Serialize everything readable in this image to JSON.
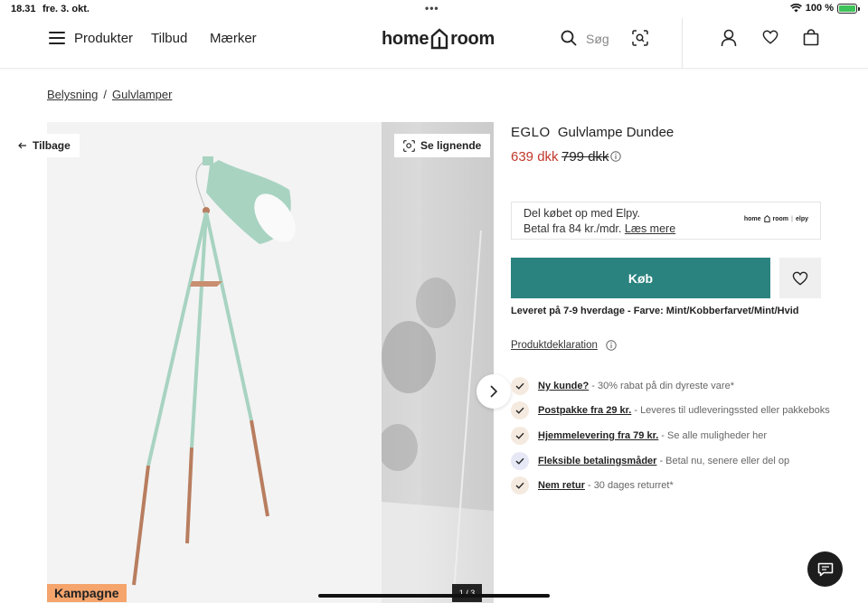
{
  "statusbar": {
    "time": "18.31",
    "date": "fre. 3. okt.",
    "dots": "•••",
    "battery_text": "100 %"
  },
  "header": {
    "nav": [
      "Produkter",
      "Tilbud",
      "Mærker"
    ],
    "logo_left": "home",
    "logo_right": "room",
    "search_placeholder": "Søg"
  },
  "breadcrumb": {
    "items": [
      "Belysning",
      "Gulvlamper"
    ],
    "separator": "/"
  },
  "gallery": {
    "back_label": "Tilbage",
    "similar_label": "Se lignende",
    "campaign_label": "Kampagne",
    "counter": "1 / 3"
  },
  "product": {
    "brand": "EGLO",
    "name": "Gulvlampe Dundee",
    "price": "639 dkk",
    "old_price": "799 dkk",
    "price_color": "#c0392b"
  },
  "elpy": {
    "line1": "Del købet op med Elpy.",
    "line2_prefix": "Betal fra 84 kr./mdr.",
    "line2_link": "Læs mere",
    "logo_home": "home",
    "logo_room": "room",
    "logo_elpy": "elpy"
  },
  "buy": {
    "label": "Køb",
    "color": "#2a837f"
  },
  "delivery_text": "Leveret på 7-9 hverdage - Farve: Mint/Kobberfarvet/Mint/Hvid",
  "declaration_label": "Produktdeklaration",
  "usps": [
    {
      "strong": "Ny kunde?",
      "text": "- 30% rabat på din dyreste vare*",
      "icon": "check-icon"
    },
    {
      "strong": "Postpakke fra 29 kr.",
      "text": "- Leveres til udleveringssted eller pakkeboks",
      "icon": "check-icon"
    },
    {
      "strong": "Hjemmelevering fra 79 kr.",
      "text": "- Se alle muligheder her",
      "icon": "check-icon"
    },
    {
      "strong": "Fleksible betalingsmåder",
      "text": "- Betal nu, senere eller del op",
      "icon": "check-icon"
    },
    {
      "strong": "Nem retur",
      "text": "- 30 dages returret*",
      "icon": "check-icon"
    }
  ],
  "colors": {
    "campaign": "#f5a46c",
    "lamp": "#a8d3c1",
    "copper": "#b87d5f"
  }
}
